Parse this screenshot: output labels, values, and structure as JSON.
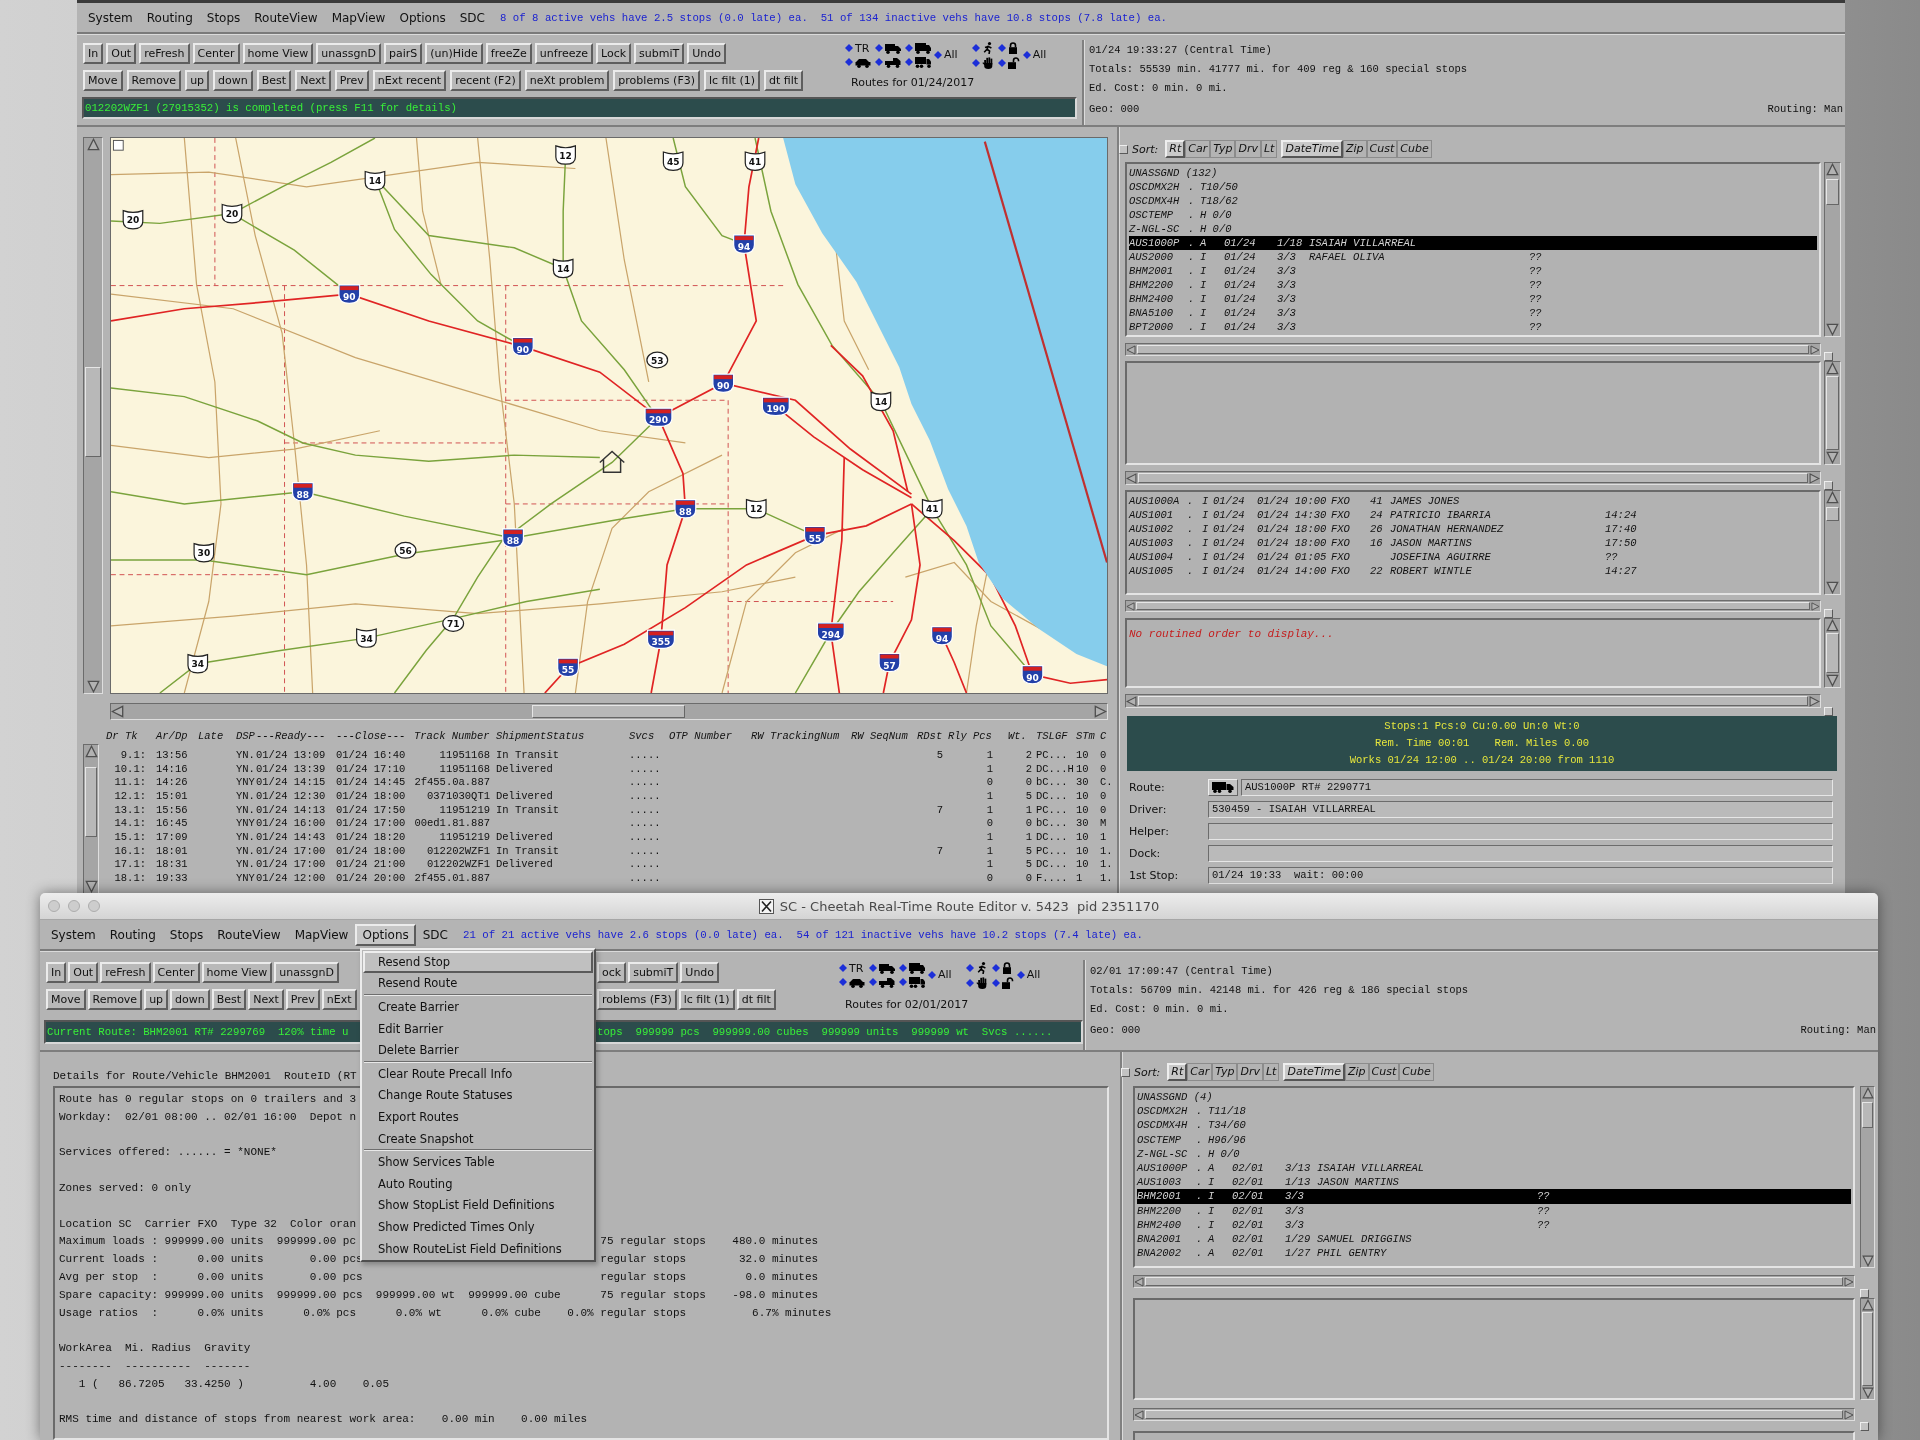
{
  "back_window": {
    "menu": [
      {
        "label": "System",
        "selected": false
      },
      {
        "label": "Routing",
        "selected": false
      },
      {
        "label": "Stops",
        "selected": false
      },
      {
        "label": "RouteView",
        "selected": false
      },
      {
        "label": "MapView",
        "selected": false
      },
      {
        "label": "Options",
        "selected": false
      },
      {
        "label": "SDC",
        "selected": false
      }
    ],
    "summary": "8 of 8 active vehs have 2.5 stops (0.0 late) ea.  51 of 134 inactive vehs have 10.8 stops (7.8 late) ea.",
    "toolbar_rows": [
      [
        "In",
        "Out",
        "reFresh",
        "Center",
        "home View",
        "unassgnD",
        "pairS",
        "(un)Hide",
        "freeZe",
        "unfreeze",
        "Lock",
        "submiT",
        "Undo"
      ],
      [
        "Move",
        "Remove",
        "up",
        "down",
        "Best",
        "Next",
        "Prev",
        "nExt recent",
        "recent (F2)",
        "neXt problem",
        "problems (F3)",
        "lc filt (1)",
        "dt filt"
      ]
    ],
    "filters": {
      "tag": "TR",
      "all_labels": [
        "All",
        "All"
      ]
    },
    "routes_for": "Routes for 01/24/2017",
    "message": "012202WZF1 (27915352) is completed (press F11 for details)",
    "info": {
      "clock": "01/24 19:33:27 (Central Time)",
      "totals": "Totals: 55539 min. 41777 mi. for 409 reg & 160 special stops",
      "ed_cost": "Ed. Cost: 0 min. 0 mi.",
      "geo": "Geo: 000",
      "routing": "Routing: Man"
    },
    "map": {
      "shields": [
        {
          "kind": "us",
          "number": "12"
        },
        {
          "kind": "us",
          "number": "45"
        },
        {
          "kind": "us",
          "number": "41"
        },
        {
          "kind": "us",
          "number": "14"
        },
        {
          "kind": "us",
          "number": "20"
        },
        {
          "kind": "us",
          "number": "20"
        },
        {
          "kind": "interstate",
          "number": "94"
        },
        {
          "kind": "us",
          "number": "14"
        },
        {
          "kind": "interstate",
          "number": "90"
        },
        {
          "kind": "interstate",
          "number": "90"
        },
        {
          "kind": "state",
          "number": "53"
        },
        {
          "kind": "interstate",
          "number": "90"
        },
        {
          "kind": "interstate",
          "number": "290"
        },
        {
          "kind": "interstate",
          "number": "190"
        },
        {
          "kind": "us",
          "number": "14"
        },
        {
          "kind": "interstate",
          "number": "88"
        },
        {
          "kind": "interstate",
          "number": "88"
        },
        {
          "kind": "us",
          "number": "12"
        },
        {
          "kind": "us",
          "number": "41"
        },
        {
          "kind": "us",
          "number": "30"
        },
        {
          "kind": "state",
          "number": "56"
        },
        {
          "kind": "interstate",
          "number": "88"
        },
        {
          "kind": "interstate",
          "number": "55"
        },
        {
          "kind": "us",
          "number": "34"
        },
        {
          "kind": "state",
          "number": "71"
        },
        {
          "kind": "interstate",
          "number": "355"
        },
        {
          "kind": "interstate",
          "number": "294"
        },
        {
          "kind": "interstate",
          "number": "94"
        },
        {
          "kind": "us",
          "number": "34"
        },
        {
          "kind": "interstate",
          "number": "55"
        },
        {
          "kind": "interstate",
          "number": "57"
        },
        {
          "kind": "interstate",
          "number": "90"
        }
      ]
    },
    "stops_table": {
      "columns": [
        "Dr Tk",
        "Ar/Dp",
        "Late",
        "DSP",
        "---Ready---",
        "---Close---",
        "Track Number",
        "ShipmentStatus",
        "Svcs",
        "OTP Number",
        "RW TrackingNum",
        "RW SeqNum",
        "RDst",
        "Rly",
        "Pcs",
        "Wt.",
        "TSLGF",
        "STm",
        "C"
      ],
      "rows": [
        {
          "dr_tk": "9.1:",
          "ar_dp": "13:56",
          "dsp": "YN.",
          "ready": "01/24 13:09",
          "close": "01/24 16:40",
          "track_number": "11951168",
          "shipment_status": "In Transit",
          "svcs": ".....",
          "rdst": "5",
          "pcs": "1",
          "wt": "2",
          "tslgf": "PC...",
          "stm": "10",
          "c": "0"
        },
        {
          "dr_tk": "10.1:",
          "ar_dp": "14:16",
          "dsp": "YN.",
          "ready": "01/24 13:39",
          "close": "01/24 17:10",
          "track_number": "11951168",
          "shipment_status": "Delivered",
          "svcs": ".....",
          "pcs": "1",
          "wt": "2",
          "tslgf": "DC...H",
          "stm": "10",
          "c": "0"
        },
        {
          "dr_tk": "11.1:",
          "ar_dp": "14:26",
          "dsp": "YNY",
          "ready": "01/24 14:15",
          "close": "01/24 14:45",
          "track_number": "2f455.0a.887",
          "svcs": ".....",
          "pcs": "0",
          "wt": "0",
          "tslgf": "bC...",
          "stm": "30",
          "c": "C."
        },
        {
          "dr_tk": "12.1:",
          "ar_dp": "15:01",
          "dsp": "YN.",
          "ready": "01/24 12:30",
          "close": "01/24 18:00",
          "track_number": "0371030QT1",
          "shipment_status": "Delivered",
          "svcs": ".....",
          "pcs": "1",
          "wt": "5",
          "tslgf": "DC...",
          "stm": "10",
          "c": "0"
        },
        {
          "dr_tk": "13.1:",
          "ar_dp": "15:56",
          "dsp": "YN.",
          "ready": "01/24 14:13",
          "close": "01/24 17:50",
          "track_number": "11951219",
          "shipment_status": "In Transit",
          "svcs": ".....",
          "rdst": "7",
          "pcs": "1",
          "wt": "1",
          "tslgf": "PC...",
          "stm": "10",
          "c": "0"
        },
        {
          "dr_tk": "14.1:",
          "ar_dp": "16:45",
          "dsp": "YNY",
          "ready": "01/24 16:00",
          "close": "01/24 17:00",
          "track_number": "00ed1.81.887",
          "svcs": ".....",
          "pcs": "0",
          "wt": "0",
          "tslgf": "bC...",
          "stm": "30",
          "c": "M"
        },
        {
          "dr_tk": "15.1:",
          "ar_dp": "17:09",
          "dsp": "YN.",
          "ready": "01/24 14:43",
          "close": "01/24 18:20",
          "track_number": "11951219",
          "shipment_status": "Delivered",
          "svcs": ".....",
          "pcs": "1",
          "wt": "1",
          "tslgf": "DC...",
          "stm": "10",
          "c": "1"
        },
        {
          "dr_tk": "16.1:",
          "ar_dp": "18:01",
          "dsp": "YN.",
          "ready": "01/24 17:00",
          "close": "01/24 18:00",
          "track_number": "012202WZF1",
          "shipment_status": "In Transit",
          "svcs": ".....",
          "rdst": "7",
          "pcs": "1",
          "wt": "5",
          "tslgf": "PC...",
          "stm": "10",
          "c": "1."
        },
        {
          "dr_tk": "17.1:",
          "ar_dp": "18:31",
          "dsp": "YN.",
          "ready": "01/24 17:00",
          "close": "01/24 21:00",
          "track_number": "012202WZF1",
          "shipment_status": "Delivered",
          "svcs": ".....",
          "pcs": "1",
          "wt": "5",
          "tslgf": "DC...",
          "stm": "10",
          "c": "1."
        },
        {
          "dr_tk": "18.1:",
          "ar_dp": "19:33",
          "dsp": "YNY",
          "ready": "01/24 12:00",
          "close": "01/24 20:00",
          "track_number": "2f455.01.887",
          "svcs": ".....",
          "pcs": "0",
          "wt": "0",
          "tslgf": "F....",
          "stm": "1",
          "c": "1."
        }
      ]
    },
    "sort": {
      "label": "Sort:",
      "groups": [
        [
          {
            "label": "Rt",
            "selected": true
          },
          {
            "label": "Car",
            "selected": false
          },
          {
            "label": "Typ",
            "selected": false
          },
          {
            "label": "Drv",
            "selected": false
          },
          {
            "label": "Lt",
            "selected": false
          }
        ],
        [
          {
            "label": "DateTime",
            "selected": true
          },
          {
            "label": "Zip",
            "selected": false
          },
          {
            "label": "Cust",
            "selected": false
          },
          {
            "label": "Cube",
            "selected": false
          }
        ]
      ]
    },
    "route_list": [
      {
        "route": "UNASSGND (132)",
        "selected": false
      },
      {
        "route": "OSCDMX2H",
        "mark": ".",
        "status": "T10/50",
        "selected": false
      },
      {
        "route": "OSCDMX4H",
        "mark": ".",
        "status": "T18/62",
        "selected": false
      },
      {
        "route": "OSCTEMP",
        "mark": ".",
        "status": "H 0/0",
        "selected": false
      },
      {
        "route": "Z-NGL-SC",
        "mark": ".",
        "status": "H 0/0",
        "selected": false
      },
      {
        "route": "AUS1000P",
        "mark": ".",
        "status": "A",
        "date": "01/24",
        "stops": "1/18",
        "driver": "ISAIAH VILLARREAL",
        "selected": true
      },
      {
        "route": "AUS2000",
        "mark": ".",
        "status": "I",
        "date": "01/24",
        "stops": "3/3",
        "driver": "RAFAEL OLIVA",
        "flag": "??",
        "selected": false
      },
      {
        "route": "BHM2001",
        "mark": ".",
        "status": "I",
        "date": "01/24",
        "stops": "3/3",
        "flag": "??",
        "selected": false
      },
      {
        "route": "BHM2200",
        "mark": ".",
        "status": "I",
        "date": "01/24",
        "stops": "3/3",
        "flag": "??",
        "selected": false
      },
      {
        "route": "BHM2400",
        "mark": ".",
        "status": "I",
        "date": "01/24",
        "stops": "3/3",
        "flag": "??",
        "selected": false
      },
      {
        "route": "BNA5100",
        "mark": ".",
        "status": "I",
        "date": "01/24",
        "stops": "3/3",
        "flag": "??",
        "selected": false
      },
      {
        "route": "BPT2000",
        "mark": ".",
        "status": "I",
        "date": "01/24",
        "stops": "3/3",
        "flag": "??",
        "selected": false
      }
    ],
    "order_list": [
      {
        "order": "AUS1000A",
        "mark": ".",
        "status": "I",
        "date": "01/24",
        "due": "01/24 10:00",
        "carrier": "FXO",
        "count": "41",
        "name": "JAMES JONES",
        "selected": false
      },
      {
        "order": "AUS1001",
        "mark": ".",
        "status": "I",
        "date": "01/24",
        "due": "01/24 14:30",
        "carrier": "FXO",
        "count": "24",
        "name": "PATRICIO IBARRIA",
        "eta": "14:24",
        "selected": false
      },
      {
        "order": "AUS1002",
        "mark": ".",
        "status": "I",
        "date": "01/24",
        "due": "01/24 18:00",
        "carrier": "FXO",
        "count": "26",
        "name": "JONATHAN HERNANDEZ",
        "eta": "17:40",
        "selected": false
      },
      {
        "order": "AUS1003",
        "mark": ".",
        "status": "I",
        "date": "01/24",
        "due": "01/24 18:00",
        "carrier": "FXO",
        "count": "16",
        "name": "JASON MARTINS",
        "eta": "17:50",
        "selected": false
      },
      {
        "order": "AUS1004",
        "mark": ".",
        "status": "I",
        "date": "01/24",
        "due": "01/24 01:05",
        "carrier": "FXO",
        "name": "JOSEFINA AGUIRRE",
        "eta": "??",
        "selected": false
      },
      {
        "order": "AUS1005",
        "mark": ".",
        "status": "I",
        "date": "01/24",
        "due": "01/24 14:00",
        "carrier": "FXO",
        "count": "22",
        "name": "ROBERT WINTLE",
        "eta": "14:27",
        "selected": false
      }
    ],
    "routined_message": "No routined order to display...",
    "route_summary": [
      "Stops:1 Pcs:0 Cu:0.00 Un:0 Wt:0",
      "Rem. Time 00:01    Rem. Miles 0.00",
      "Works 01/24 12:00 .. 01/24 20:00 from 1110"
    ],
    "fields": [
      {
        "kind": "vehicle",
        "label": "Route:",
        "value": "AUS1000P RT# 2290771"
      },
      {
        "kind": "text",
        "label": "Driver:",
        "value": "530459 - ISAIAH VILLARREAL"
      },
      {
        "kind": "text",
        "label": "Helper:"
      },
      {
        "kind": "text",
        "label": "Dock:"
      },
      {
        "kind": "text",
        "label": "1st Stop:",
        "value": "01/24 19:33  wait: 00:00"
      }
    ]
  },
  "front_window": {
    "title": "SC - Cheetah Real-Time Route Editor v. 5423  pid 2351170",
    "menu": [
      {
        "label": "System",
        "selected": false
      },
      {
        "label": "Routing",
        "selected": false
      },
      {
        "label": "Stops",
        "selected": false
      },
      {
        "label": "RouteView",
        "selected": false
      },
      {
        "label": "MapView",
        "selected": false
      },
      {
        "label": "Options",
        "selected": true
      },
      {
        "label": "SDC",
        "selected": false
      }
    ],
    "summary": "21 of 21 active vehs have 2.6 stops (0.0 late) ea.  54 of 121 inactive vehs have 10.2 stops (7.4 late) ea.",
    "toolbar_rows": [
      {
        "before_menu": [
          "In",
          "Out",
          "reFresh",
          "Center",
          "home View",
          "unassgnD"
        ],
        "after_menu": [
          "ock",
          "submiT",
          "Undo"
        ]
      },
      {
        "before_menu": [
          "Move",
          "Remove",
          "up",
          "down",
          "Best",
          "Next",
          "Prev",
          "nExt"
        ],
        "after_menu": [
          "roblems (F3)",
          "lc filt (1)",
          "dt filt"
        ]
      }
    ],
    "filters": {
      "tag": "TR",
      "all_labels": [
        "All",
        "All"
      ]
    },
    "routes_for": "Routes for 02/01/2017",
    "status": {
      "before_menu": "Current Route: BHM2001 RT# 2299769  120% time u",
      "after_menu": "tops  999999 pcs  999999.00 cubes  999999 units  999999 wt  Svcs ......"
    },
    "info": {
      "clock": "02/01 17:09:47 (Central Time)",
      "totals": "Totals: 56709 min. 42148 mi. for 426 reg & 186 special stops",
      "ed_cost": "Ed. Cost: 0 min. 0 mi.",
      "geo": "Geo: 000",
      "routing": "Routing: Man"
    },
    "options_menu": [
      [
        {
          "label": "Resend Stop",
          "selected": true
        },
        {
          "label": "Resend Route",
          "selected": false
        }
      ],
      [
        {
          "label": "Create Barrier",
          "selected": false
        },
        {
          "label": "Edit Barrier",
          "selected": false
        },
        {
          "label": "Delete Barrier",
          "selected": false
        }
      ],
      [
        {
          "label": "Clear Route Precall Info",
          "selected": false
        },
        {
          "label": "Change Route Statuses",
          "selected": false
        },
        {
          "label": "Export Routes",
          "selected": false
        },
        {
          "label": "Create Snapshot",
          "selected": false
        }
      ],
      [
        {
          "label": "Show Services Table",
          "selected": false
        },
        {
          "label": "Auto Routing",
          "selected": false
        },
        {
          "label": "Show StopList Field Definitions",
          "selected": false
        },
        {
          "label": "Show Predicted Times Only",
          "selected": false
        },
        {
          "label": "Show RouteList Field Definitions",
          "selected": false
        }
      ]
    ],
    "details": {
      "title": "Details for Route/Vehicle BHM2001  RouteID (RT",
      "blocks": [
        [
          {
            "text": "Route has 0 regular stops on 0 trailers and 3"
          },
          {
            "text": "Workday:  02/01 08:00 .. 02/01 16:00  Depot n"
          }
        ],
        [
          {
            "text": "Services offered: ...... = *NONE*"
          }
        ],
        [
          {
            "text": "Zones served: 0 only"
          }
        ],
        [
          {
            "text": "Location SC  Carrier FXO  Type 32  Color oran"
          },
          {
            "text": "Maximum loads : 999999.00 units  999999.00 pc",
            "tail": "75 regular stops    480.0 minutes"
          },
          {
            "text": "Current loads :      0.00 units       0.00 pcs",
            "tail": "regular stops        32.0 minutes"
          },
          {
            "text": "Avg per stop  :      0.00 units       0.00 pcs",
            "tail": "regular stops         0.0 minutes"
          },
          {
            "text": "Spare capacity: 999999.00 units  999999.00 pcs  999999.00 wt  999999.00 cube      75 regular stops    -98.0 minutes"
          },
          {
            "text": "Usage ratios  :      0.0% units      0.0% pcs      0.0% wt      0.0% cube    0.0% regular stops          6.7% minutes"
          }
        ],
        [
          {
            "text": "WorkArea  Mi. Radius  Gravity"
          },
          {
            "text": "--------  ----------  -------"
          },
          {
            "text": "   1 (   86.7205   33.4250 )          4.00    0.05"
          }
        ],
        [
          {
            "text": "RMS time and distance of stops from nearest work area:    0.00 min    0.00 miles"
          }
        ]
      ]
    },
    "sort": {
      "label": "Sort:",
      "groups": [
        [
          {
            "label": "Rt",
            "selected": true
          },
          {
            "label": "Car",
            "selected": false
          },
          {
            "label": "Typ",
            "selected": false
          },
          {
            "label": "Drv",
            "selected": false
          },
          {
            "label": "Lt",
            "selected": false
          }
        ],
        [
          {
            "label": "DateTime",
            "selected": true
          },
          {
            "label": "Zip",
            "selected": false
          },
          {
            "label": "Cust",
            "selected": false
          },
          {
            "label": "Cube",
            "selected": false
          }
        ]
      ]
    },
    "route_list": [
      {
        "route": "UNASSGND (4)",
        "selected": false
      },
      {
        "route": "OSCDMX2H",
        "mark": ".",
        "status": "T11/18",
        "selected": false
      },
      {
        "route": "OSCDMX4H",
        "mark": ".",
        "status": "T34/60",
        "selected": false
      },
      {
        "route": "OSCTEMP",
        "mark": ".",
        "status": "H96/96",
        "selected": false
      },
      {
        "route": "Z-NGL-SC",
        "mark": ".",
        "status": "H 0/0",
        "selected": false
      },
      {
        "route": "AUS1000P",
        "mark": ".",
        "status": "A",
        "date": "02/01",
        "stops": "3/13",
        "driver": "ISAIAH VILLARREAL",
        "selected": false
      },
      {
        "route": "AUS1003",
        "mark": ".",
        "status": "I",
        "date": "02/01",
        "stops": "1/13",
        "driver": "JASON MARTINS",
        "selected": false
      },
      {
        "route": "BHM2001",
        "mark": ".",
        "status": "I",
        "date": "02/01",
        "stops": "3/3",
        "flag": "??",
        "selected": true
      },
      {
        "route": "BHM2200",
        "mark": ".",
        "status": "I",
        "date": "02/01",
        "stops": "3/3",
        "flag": "??",
        "selected": false
      },
      {
        "route": "BHM2400",
        "mark": ".",
        "status": "I",
        "date": "02/01",
        "stops": "3/3",
        "flag": "??",
        "selected": false
      },
      {
        "route": "BNA2001",
        "mark": ".",
        "status": "A",
        "date": "02/01",
        "stops": "1/29",
        "driver": "SAMUEL DRIGGINS",
        "selected": false
      },
      {
        "route": "BNA2002",
        "mark": ".",
        "status": "A",
        "date": "02/01",
        "stops": "1/27",
        "driver": "PHIL GENTRY",
        "selected": false
      }
    ]
  }
}
